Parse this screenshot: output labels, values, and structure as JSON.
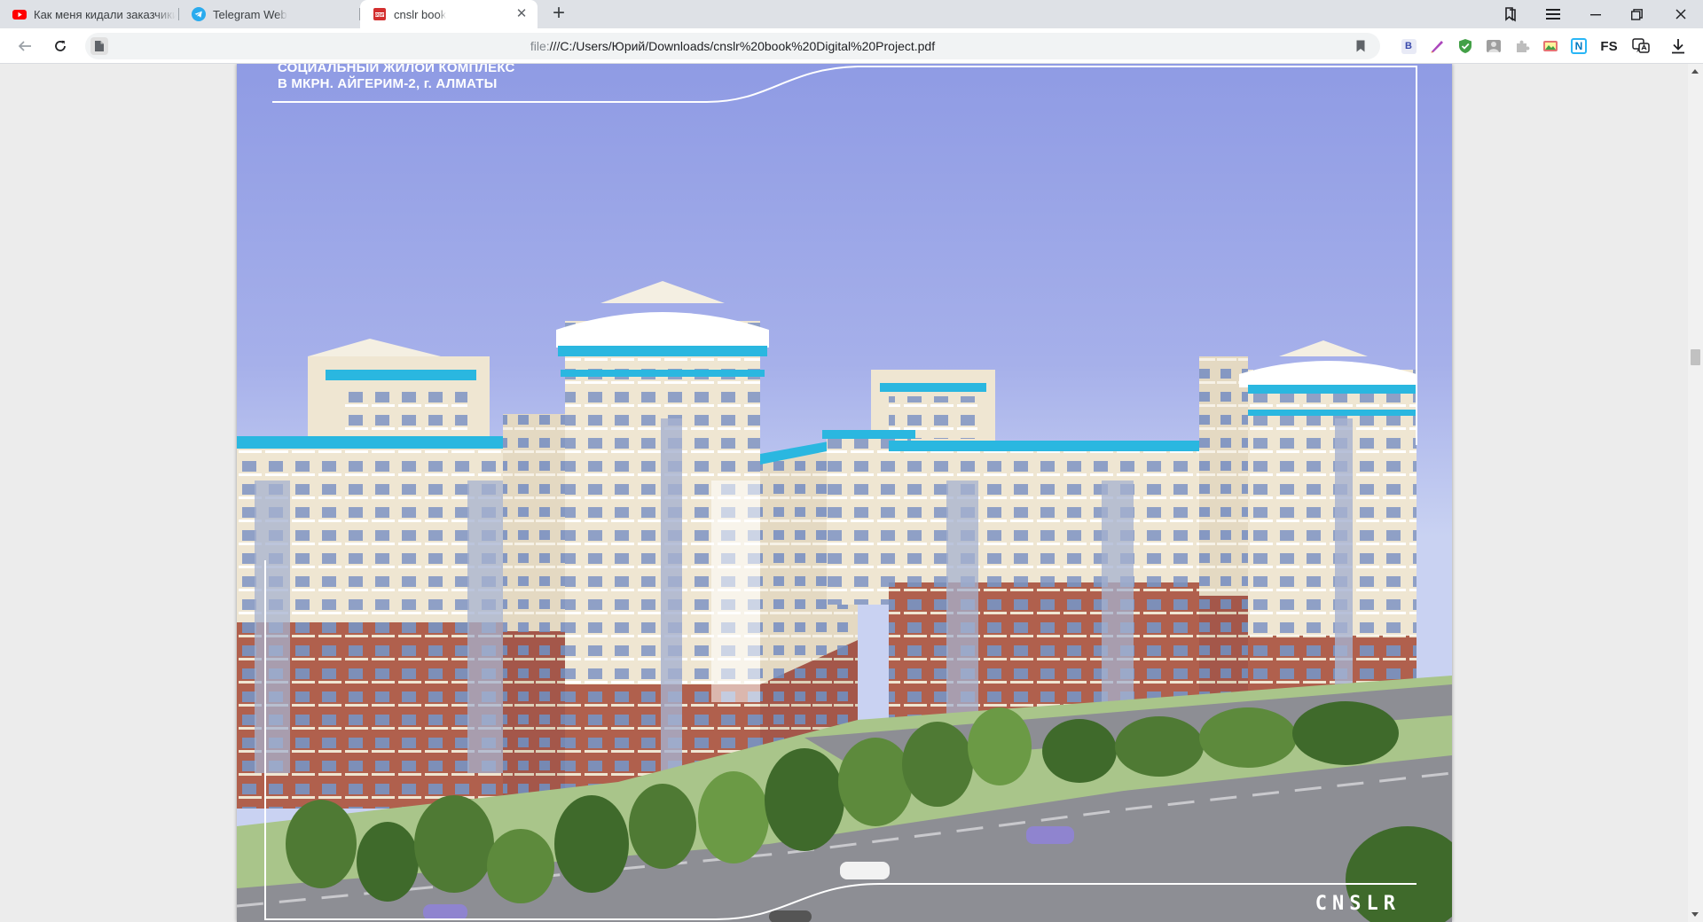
{
  "tabs": [
    {
      "title": "Как меня кидали заказчики",
      "icon": "youtube-icon"
    },
    {
      "title": "Telegram Web",
      "icon": "telegram-icon"
    },
    {
      "title": "cnslr book",
      "icon": "pdf-icon",
      "active": true
    }
  ],
  "toolbar": {
    "url_scheme": "file:",
    "url_path": "///C:/Users/Юрий/Downloads/cnslr%20book%20Digital%20Project.pdf"
  },
  "extensions": [
    {
      "icon": "b-extension-icon",
      "label": "B"
    },
    {
      "icon": "pen-extension-icon",
      "label": ""
    },
    {
      "icon": "shield-extension-icon",
      "label": ""
    },
    {
      "icon": "portrait-extension-icon",
      "label": ""
    },
    {
      "icon": "puzzle-extension-icon",
      "label": ""
    },
    {
      "icon": "image-extension-icon",
      "label": ""
    },
    {
      "icon": "n-extension-icon",
      "label": "N"
    },
    {
      "icon": "fs-extension-icon",
      "label": "FS"
    }
  ],
  "document": {
    "heading_line1": "СОЦИАЛЬНЫЙ ЖИЛОЙ КОМПЛЕКС",
    "heading_line2": "В МКРН. АЙГЕРИМ-2, г. АЛМАТЫ",
    "logo": "CNSLR"
  },
  "colors": {
    "accent_blue": "#2ab7e0",
    "brick": "#b0604d",
    "facade": "#efe6d2",
    "sky_top": "#8f9be4",
    "sky_bottom": "#c9d2f2"
  }
}
